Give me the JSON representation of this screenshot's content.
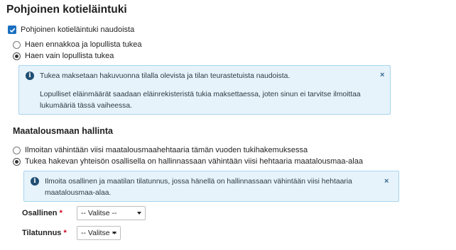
{
  "section": {
    "title": "Pohjoinen kotieläintuki",
    "checkbox_label": "Pohjoinen kotieläintuki naudoista",
    "radio_options": [
      "Haen ennakkoa ja lopullista tukea",
      "Haen vain lopullista tukea"
    ],
    "selected_radio": 1,
    "info": {
      "line1": "Tukea maksetaan hakuvuonna tilalla olevista ja tilan teurastetuista naudoista.",
      "line2": "Lopulliset eläinmäärät saadaan eläinrekisteristä tukia maksettaessa, joten sinun ei tarvitse ilmoittaa",
      "line3": "lukumääriä tässä vaiheessa.",
      "close": "×"
    }
  },
  "land": {
    "title": "Maatalousmaan hallinta",
    "radio_options": [
      "Ilmoitan vähintään viisi maatalousmaahehtaaria tämän vuoden tukihakemuksessa",
      "Tukea hakevan yhteisön osallisella on hallinnassaan vähintään viisi hehtaaria maatalousmaa-alaa"
    ],
    "selected_radio": 1,
    "info": {
      "line1": "Ilmoita osallinen ja maatilan tilatunnus, jossa hänellä on hallinnassaan vähintään viisi hehtaaria",
      "line2": "maatalousmaa-alaa.",
      "close": "×"
    },
    "fields": [
      {
        "label": "Osallinen",
        "required": "*",
        "value": "-- Valitse --"
      },
      {
        "label": "Tilatunnus",
        "required": "*",
        "value": "-- Valitse --"
      }
    ]
  },
  "colors": {
    "accent": "#1b6fc0",
    "info_bg": "#e6f3fb",
    "info_border": "#a9d4ee",
    "required": "#d0021b"
  }
}
